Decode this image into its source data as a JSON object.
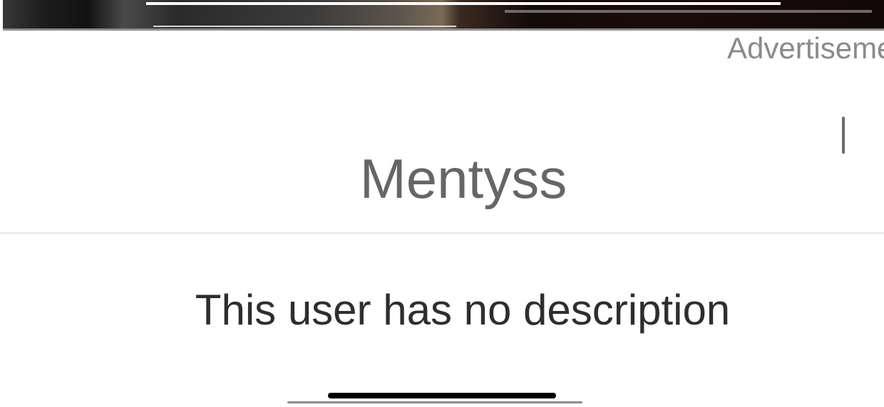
{
  "ad": {
    "label": "Advertiseme"
  },
  "profile": {
    "username": "Mentyss",
    "description": "This user has no description"
  }
}
